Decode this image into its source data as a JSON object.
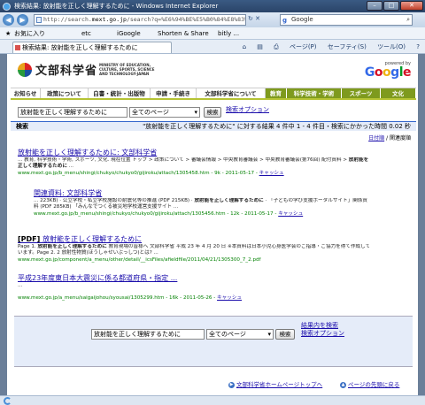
{
  "window": {
    "title": "検索結果: 放射能を正しく理解するために - Windows Internet Explorer"
  },
  "address": {
    "url_prefix": "http://search.",
    "url_host": "mext.go.jp",
    "url_rest": "/search?q=%E6%94%BE%E5%B0%84%E8%83%BD%E3%82..."
  },
  "search_engine": {
    "name": "Google"
  },
  "favorites": {
    "label": "お気に入り",
    "items": [
      "etc",
      "iGoogle",
      "Shorten & Share",
      "bitly ..."
    ]
  },
  "tab": {
    "label": "検索結果: 放射能を正しく理解するために"
  },
  "toolbar": {
    "items": [
      "ページ(P)",
      "セーフティ(S)",
      "ツール(O)"
    ]
  },
  "site": {
    "logo_text": "文部科学省",
    "logo_sub": "MINISTRY OF EDUCATION, CULTURE, SPORTS, SCIENCE AND TECHNOLOGY-JAPAN",
    "powered_by": "powered by",
    "google_g": "G",
    "google_o1": "o",
    "google_o2": "o",
    "google_g2": "g",
    "google_l": "l",
    "google_e": "e"
  },
  "nav": [
    "お知らせ",
    "政策について",
    "白書・統計・出版物",
    "申請・手続き",
    "文部科学省について",
    "教育",
    "科学技術・学術",
    "スポーツ",
    "文化"
  ],
  "search": {
    "query": "放射能を正しく理解するために",
    "scope": "全てのページ",
    "button": "検索",
    "options_link": "検索オプション"
  },
  "results_bar": {
    "label": "検索",
    "info": "\"放射能を正しく理解するために\" に対する結果 4 件中 1 - 4 件目・検索にかかった時間 0.02 秒"
  },
  "sort": {
    "by_date": "日付順",
    "separator": " / ",
    "by_relevance": "関連度順"
  },
  "results": [
    {
      "pdf": "",
      "title": "放射能を正しく理解するために: 文部科学省",
      "snippet": "... 教育, 科学技術・学術, スポーツ, 文化. 現在位置 トップ > 政策について > 審議会情報 > 中央教育審議会 > 中央教育審議会(第76回) 配付資料 > 放射能を正しく理解するために ...",
      "url": "www.mext.go.jp/b_menu/shingi/chukyo/chukyo0/gijiroku/attach/1305458.htm - 9k - 2011-05-17 - ",
      "cache": "キャッシュ"
    },
    {
      "pdf": "",
      "title": "関連資料: 文部科学省",
      "snippet": "... 223KB) · 公立学校・私立学校施設の耐震化等の推進 (PDF 215KB) · 放射能を正しく理解するために · 「子どもの学び支援ポータルサイト」関係資料 (PDF 285KB) 「みんなでつくる被災地学校運営支援サイト ...",
      "url": "www.mext.go.jp/b_menu/shingi/chukyo/chukyo0/gijiroku/attach/1305456.htm - 12k - 2011-05-17 - ",
      "cache": "キャッシュ"
    },
    {
      "pdf": "[PDF] ",
      "title": "放射能を正しく理解するために",
      "snippet": "Page 1. 放射能を正しく理解するために 教育現場の皆様へ 文部科学省 平成 23 年 4 月 20 日 ※本資料は日本小児心身医学会のご指導・ご協力を得て作成しています。Page 2. 2 放射性物質(ほうしゃせいぶっしつ)とは? ...",
      "url": "www.mext.go.jp/component/a_menu/other/detail/__icsFiles/afieldfile/2011/04/21/1305300_7_2.pdf",
      "cache": ""
    },
    {
      "pdf": "",
      "title": "平成23年度東日本大震災に係る都道府県・指定 ...",
      "snippet": "...",
      "url": "www.mext.go.jp/a_menu/saigaijohou/syousai/1305299.htm - 16k - 2011-05-26 - ",
      "cache": "キャッシュ"
    }
  ],
  "bottom": {
    "query": "放射能を正しく理解するために",
    "scope": "全てのページ",
    "button": "検索",
    "within_link": "結果内を検索",
    "options_link": "検索オプション"
  },
  "footer": {
    "home_link": "文部科学省ホームページトップへ",
    "top_link": "ページの先頭に戻る"
  }
}
